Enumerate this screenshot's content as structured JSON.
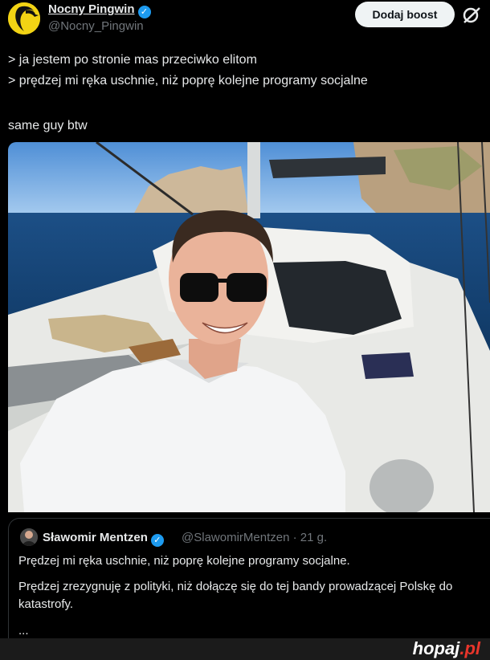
{
  "author": {
    "name": "Nocny Pingwin",
    "handle": "@Nocny_Pingwin"
  },
  "actions": {
    "boost_label": "Dodaj boost"
  },
  "tweet": {
    "lines": [
      "> ja jestem po stronie mas przeciwko elitom",
      "> prędzej mi ręka uschnie, niż poprę kolejne programy socjalne",
      "same guy btw"
    ]
  },
  "quoted_tweet": {
    "name": "Sławomir Mentzen",
    "handle": "@SlawomirMentzen · 21 g.",
    "paragraphs": [
      "Prędzej mi ręka uschnie, niż poprę kolejne programy socjalne.",
      "Prędzej zrezygnuję z polityki, niż dołączę się do tej bandy prowadzącej Polskę do katastrofy."
    ],
    "ellipsis": "..."
  },
  "watermark": {
    "text": "hopaj",
    "suffix": ".pl"
  },
  "colors": {
    "background": "#000000",
    "text": "#e7e9ea",
    "muted": "#71767b",
    "verified": "#1d9bf0",
    "boost_bg": "#eff3f4"
  },
  "icons": {
    "avatar": "penguin-avatar",
    "verified": "verified-badge-icon",
    "grok": "grok-slash-icon"
  }
}
